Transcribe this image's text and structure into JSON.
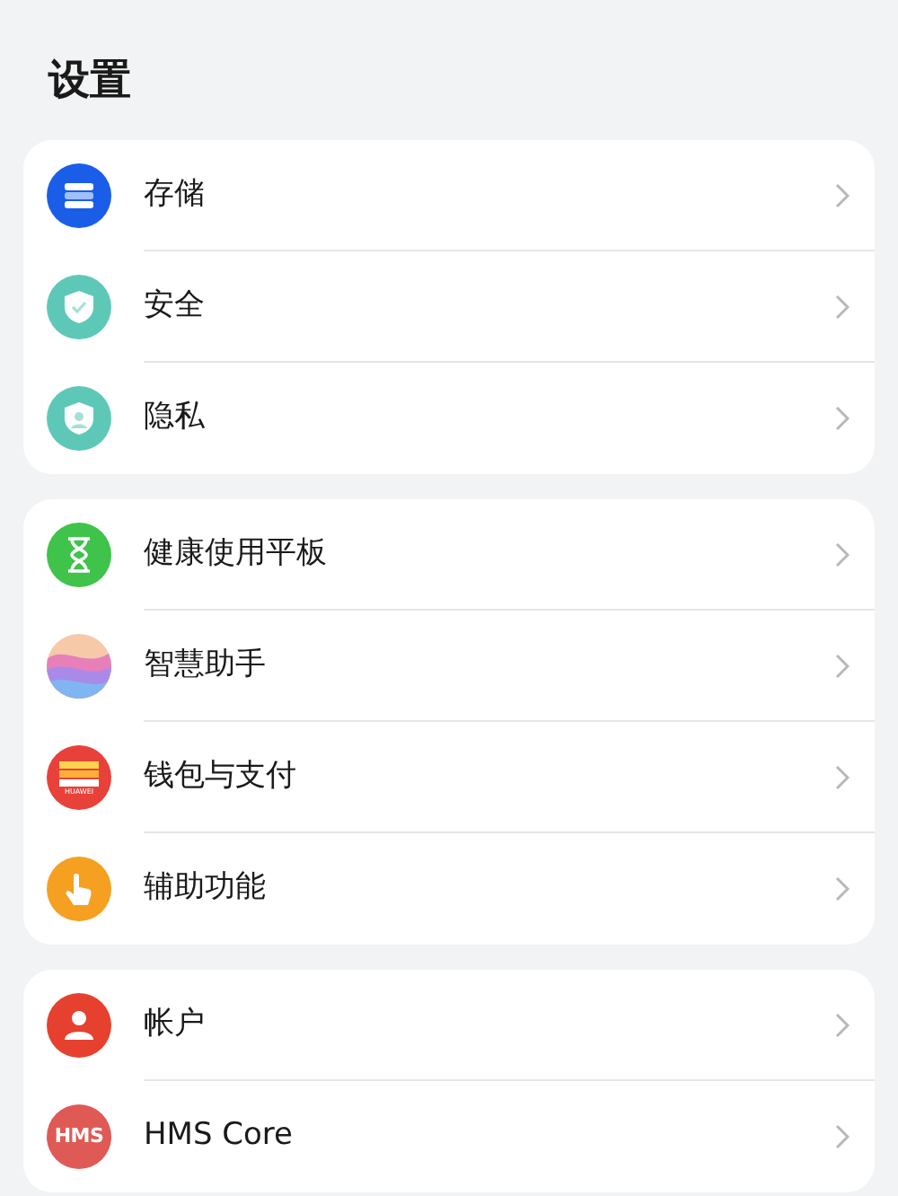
{
  "title": "设置",
  "groups": [
    {
      "items": [
        {
          "label": "存储",
          "kind": "storage",
          "color": "#1a5ee8"
        },
        {
          "label": "安全",
          "kind": "security",
          "color": "#5ec8b8"
        },
        {
          "label": "隐私",
          "kind": "privacy",
          "color": "#5ec8b8"
        }
      ]
    },
    {
      "items": [
        {
          "label": "健康使用平板",
          "kind": "hourglass",
          "color": "#3fc34a"
        },
        {
          "label": "智慧助手",
          "kind": "assistant"
        },
        {
          "label": "钱包与支付",
          "kind": "wallet",
          "color": "#e8413a",
          "icon_text": "HUAWEI"
        },
        {
          "label": "辅助功能",
          "kind": "accessibility",
          "color": "#f5a020"
        }
      ]
    },
    {
      "items": [
        {
          "label": "帐户",
          "kind": "account",
          "color": "#e5412e"
        },
        {
          "label": "HMS Core",
          "kind": "hms",
          "color": "#e05a55",
          "icon_text": "HMS"
        }
      ]
    }
  ]
}
